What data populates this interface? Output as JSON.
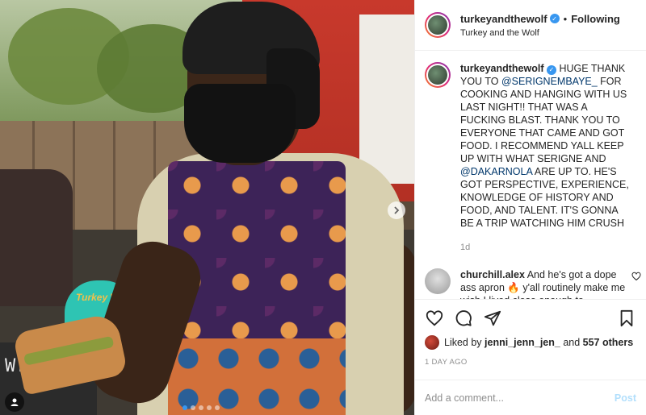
{
  "post": {
    "username": "turkeyandthewolf",
    "following_label": "Following",
    "bullet": "•",
    "subtitle": "Turkey and the Wolf",
    "caption": {
      "username": "turkeyandthewolf",
      "part1": "HUGE THANK YOU TO ",
      "mention1": "@SERIGNEMBAYE_",
      "part2": " FOR COOKING AND HANGING WITH US LAST NIGHT!! THAT WAS A FUCKING BLAST. THANK YOU TO EVERYONE THAT CAME AND GOT FOOD. I RECOMMEND YALL KEEP UP WITH WHAT SERIGNE AND ",
      "mention2": "@DAKARNOLA",
      "part3": " ARE UP TO. HE'S GOT PERSPECTIVE, EXPERIENCE, KNOWLEDGE OF HISTORY AND FOOD, AND TALENT. IT'S GONNA BE A TRIP WATCHING HIM CRUSH",
      "age": "1d"
    },
    "comments": [
      {
        "username": "churchill.alex",
        "text": "And he's got a dope ass apron 🔥 y'all routinely make me wish I lived close enough to"
      }
    ],
    "likes": {
      "prefix": "Liked by ",
      "liker": "jenni_jenn_jen_",
      "and": " and ",
      "count": "557 others"
    },
    "date": "1 DAY AGO"
  },
  "photo": {
    "chalk_text": "WELCOME",
    "cart_text": "Turkey Wolf",
    "carousel_dots": 5,
    "active_dot": 0
  },
  "composer": {
    "placeholder": "Add a comment...",
    "post_label": "Post"
  },
  "icons": {
    "verified": "verified-badge-icon",
    "like": "heart-icon",
    "comment": "comment-bubble-icon",
    "share": "paper-plane-icon",
    "save": "bookmark-icon",
    "next": "chevron-right-icon",
    "tag": "user-tag-icon"
  },
  "colors": {
    "accent": "#3897f0",
    "text": "#262626",
    "muted": "#8e8e8e",
    "link": "#00376b",
    "post_disabled": "#b2dffc"
  }
}
